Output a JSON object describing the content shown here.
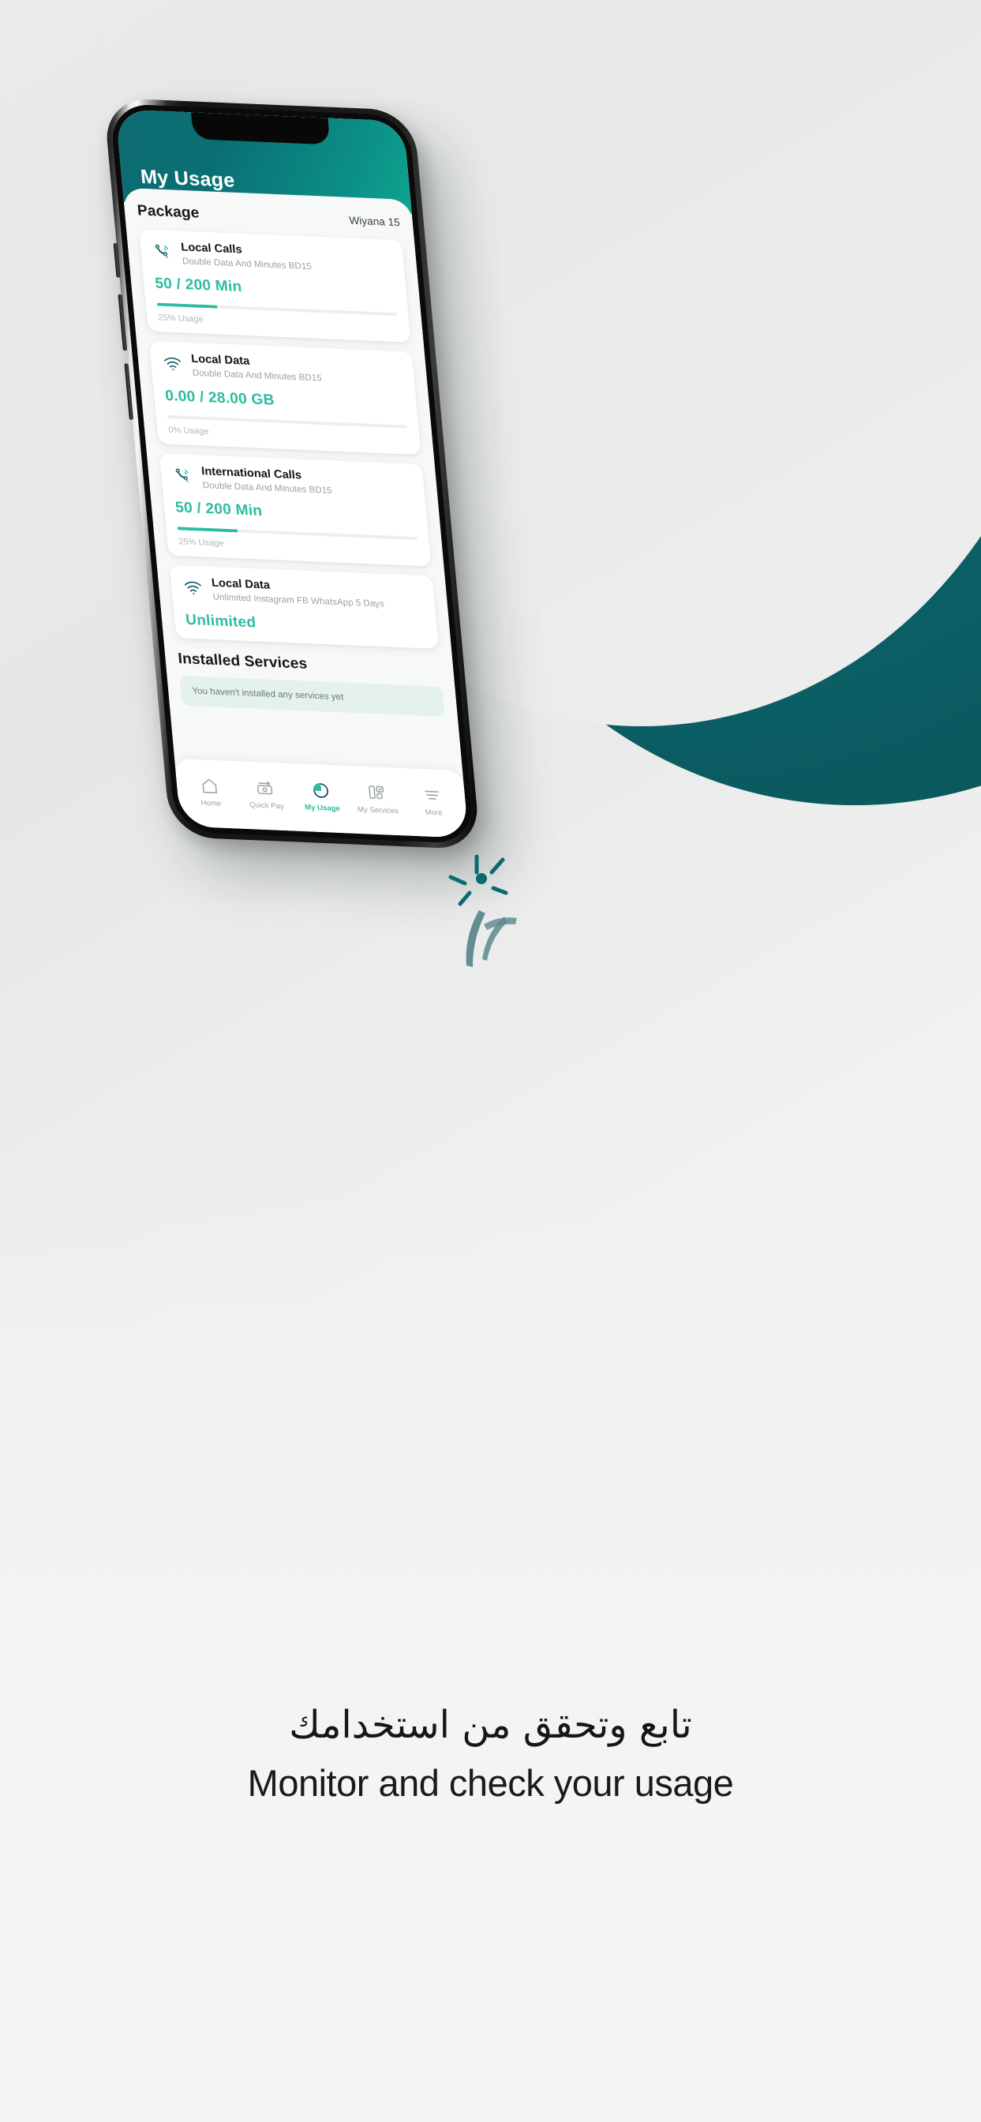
{
  "app": {
    "title": "My Usage",
    "notch": "phone-notch"
  },
  "package_section": {
    "heading": "Package",
    "plan_name": "Wiyana 15"
  },
  "usage_cards": [
    {
      "icon": "phone-call-icon",
      "title": "Local Calls",
      "subtitle": "Double Data And Minutes BD15",
      "amount": "50 / 200 Min",
      "usage_label": "25% Usage",
      "progress_percent": 25,
      "has_progress": true
    },
    {
      "icon": "wifi-icon",
      "title": "Local Data",
      "subtitle": "Double Data And Minutes BD15",
      "amount": "0.00 / 28.00 GB",
      "usage_label": "0% Usage",
      "progress_percent": 0,
      "has_progress": true
    },
    {
      "icon": "phone-call-icon",
      "title": "International Calls",
      "subtitle": "Double Data And Minutes BD15",
      "amount": "50 / 200 Min",
      "usage_label": "25% Usage",
      "progress_percent": 25,
      "has_progress": true
    },
    {
      "icon": "wifi-icon",
      "title": "Local Data",
      "subtitle": "Unlimited Instagram FB WhatsApp 5 Days",
      "amount": "Unlimited",
      "usage_label": "",
      "progress_percent": 0,
      "has_progress": false
    }
  ],
  "installed_services": {
    "heading": "Installed Services",
    "empty_message": "You haven't installed any services yet"
  },
  "bottom_nav": [
    {
      "icon": "home-icon",
      "label": "Home",
      "active": false
    },
    {
      "icon": "quick-pay-icon",
      "label": "Quick Pay",
      "active": false
    },
    {
      "icon": "pie-chart-icon",
      "label": "My Usage",
      "active": true
    },
    {
      "icon": "services-grid-icon",
      "label": "My Services",
      "active": false
    },
    {
      "icon": "more-lines-icon",
      "label": "More",
      "active": false
    }
  ],
  "tagline": {
    "arabic": "تابع وتحقق من استخدامك",
    "english": "Monitor and check your usage"
  },
  "colors": {
    "brand_teal": "#0b6a70",
    "accent_green": "#2bbd9e",
    "header_gradient_start": "#0c6b70",
    "header_gradient_end": "#0fa58f",
    "page_background": "#f2f2f2",
    "card_background": "#ffffff",
    "empty_state_background": "#e4f1ee",
    "muted_text": "#9aa1a5"
  }
}
